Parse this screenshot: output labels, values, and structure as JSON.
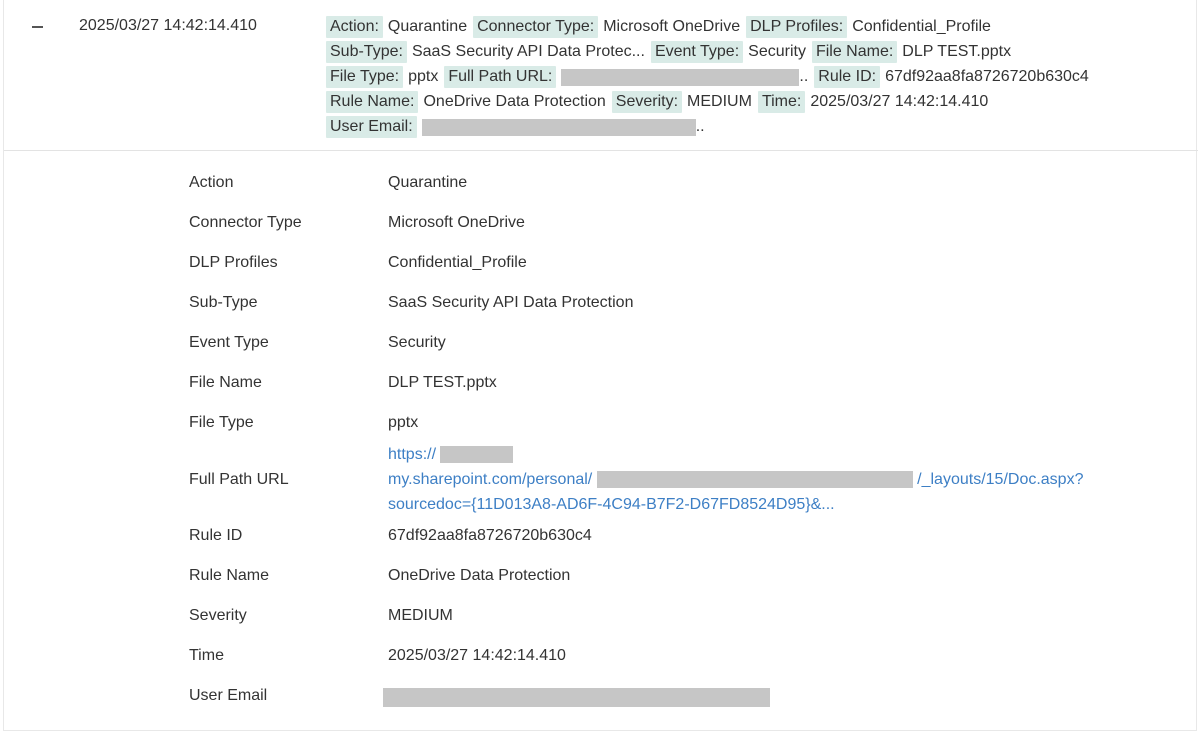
{
  "row": {
    "timestamp": "2025/03/27 14:42:14.410",
    "summary": {
      "action_tag": "Action:",
      "action_val": "Quarantine",
      "connector_tag": "Connector Type:",
      "connector_val": "Microsoft OneDrive",
      "dlp_tag": "DLP Profiles:",
      "dlp_val": "Confidential_Profile",
      "subtype_tag": "Sub-Type:",
      "subtype_val": "SaaS Security API Data Protec...",
      "event_tag": "Event Type:",
      "event_val": "Security",
      "filename_tag": "File Name:",
      "filename_val": "DLP TEST.pptx",
      "filetype_tag": "File Type:",
      "filetype_val": "pptx",
      "fullpath_tag": "Full Path URL:",
      "fullpath_trail": "..",
      "ruleid_tag": "Rule ID:",
      "ruleid_val": "67df92aa8fa8726720b630c4",
      "rulename_tag": "Rule Name:",
      "rulename_val": "OneDrive Data Protection",
      "severity_tag": "Severity:",
      "severity_val": "MEDIUM",
      "time_tag": "Time:",
      "time_val": "2025/03/27 14:42:14.410",
      "useremail_tag": "User Email:",
      "useremail_trail": ".."
    }
  },
  "details": {
    "action": {
      "label": "Action",
      "value": "Quarantine"
    },
    "connector": {
      "label": "Connector Type",
      "value": "Microsoft OneDrive"
    },
    "dlp": {
      "label": "DLP Profiles",
      "value": "Confidential_Profile"
    },
    "subtype": {
      "label": "Sub-Type",
      "value": "SaaS Security API Data Protection"
    },
    "event": {
      "label": "Event Type",
      "value": "Security"
    },
    "filename": {
      "label": "File Name",
      "value": "DLP TEST.pptx"
    },
    "filetype": {
      "label": "File Type",
      "value": "pptx"
    },
    "fullpath": {
      "label": "Full Path URL",
      "line1": "https://",
      "line2_a": "my.sharepoint.com/personal/",
      "line2_b": "/_layouts/15/Doc.aspx?",
      "line3": "sourcedoc={11D013A8-AD6F-4C94-B7F2-D67FD8524D95}&..."
    },
    "ruleid": {
      "label": "Rule ID",
      "value": "67df92aa8fa8726720b630c4"
    },
    "rulename": {
      "label": "Rule Name",
      "value": "OneDrive Data Protection"
    },
    "severity": {
      "label": "Severity",
      "value": "MEDIUM"
    },
    "time": {
      "label": "Time",
      "value": "2025/03/27 14:42:14.410"
    },
    "useremail": {
      "label": "User Email"
    }
  },
  "colors": {
    "tag_bg": "#d9ebe7",
    "link": "#3d7fc5",
    "redaction": "#c6c6c6"
  }
}
